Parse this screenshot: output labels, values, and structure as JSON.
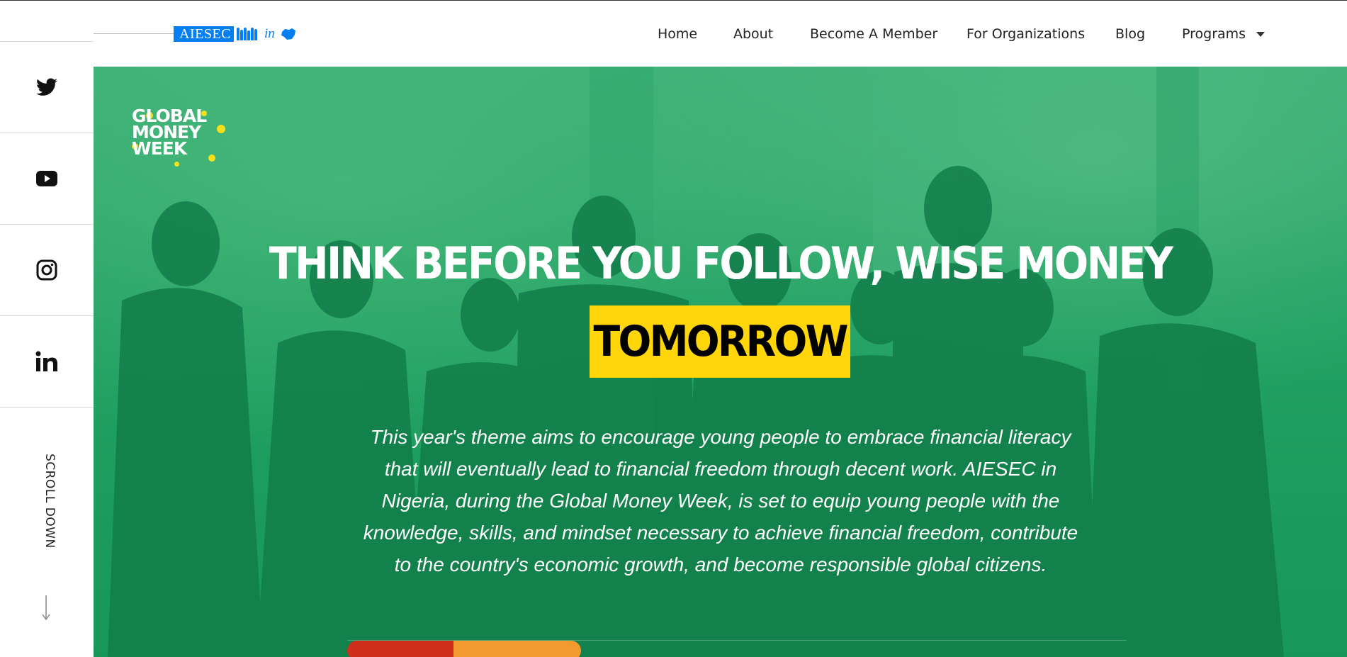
{
  "header": {
    "logo_text": "AIESEC",
    "logo_suffix": "in",
    "nav": [
      {
        "label": "Home"
      },
      {
        "label": "About"
      },
      {
        "label": "Become A Member"
      },
      {
        "label": "For Organizations"
      },
      {
        "label": "Blog"
      },
      {
        "label": "Programs"
      }
    ]
  },
  "social": {
    "items": [
      {
        "icon": "twitter-icon"
      },
      {
        "icon": "youtube-icon"
      },
      {
        "icon": "instagram-icon"
      },
      {
        "icon": "linkedin-icon"
      }
    ],
    "scroll_label": "SCROLL DOWN"
  },
  "hero": {
    "badge_lines": [
      "GLOBAL",
      "MONEY",
      "WEEK"
    ],
    "headline": "THINK BEFORE YOU FOLLOW, WISE MONEY",
    "highlight": "TOMORROW",
    "description": "This year's theme aims to encourage young people to embrace financial literacy that will eventually lead to financial freedom through decent work. AIESEC in Nigeria, during the Global Money Week, is set to equip young people with the knowledge, skills, and mindset necessary to achieve financial freedom, contribute to the country's economic growth, and become responsible global citizens.",
    "colors": {
      "overlay": "#17a05e",
      "highlight": "#ffd60a",
      "progress_red": "#d0301b",
      "progress_orange": "#f29a2e"
    }
  }
}
